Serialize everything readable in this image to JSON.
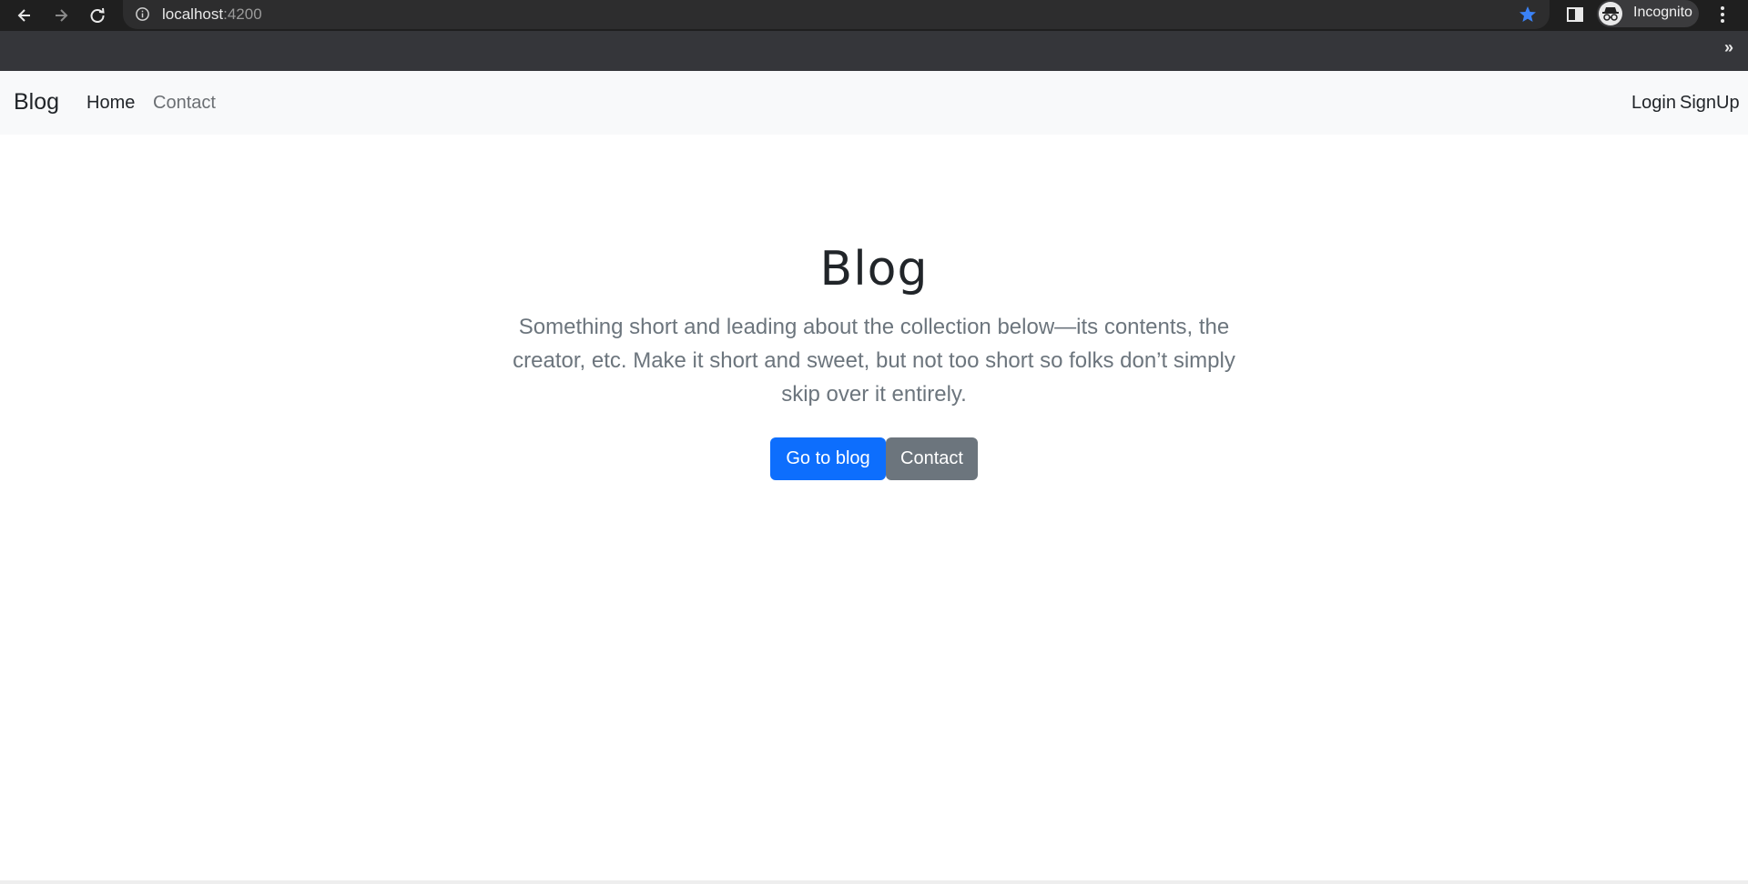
{
  "browser": {
    "url_host": "localhost",
    "url_port": ":4200",
    "profile_label": "Incognito",
    "bookmarks_overflow": "»",
    "accent_star_color": "#3b82f6"
  },
  "navbar": {
    "brand": "Blog",
    "links": [
      {
        "label": "Home"
      },
      {
        "label": "Contact"
      }
    ],
    "login": "Login",
    "signup": "SignUp"
  },
  "hero": {
    "title": "Blog",
    "lead": "Something short and leading about the collection below—its contents, the creator, etc. Make it short and sweet, but not too short so folks don’t simply skip over it entirely.",
    "primary_button": "Go to blog",
    "secondary_button": "Contact"
  },
  "colors": {
    "primary": "#0d6efd",
    "secondary": "#6c757d",
    "navbar_bg": "#f8f9fa"
  },
  "icons": [
    "back-arrow-icon",
    "forward-arrow-icon",
    "reload-icon",
    "info-icon",
    "star-icon",
    "side-panel-icon",
    "incognito-icon",
    "kebab-menu-icon"
  ]
}
